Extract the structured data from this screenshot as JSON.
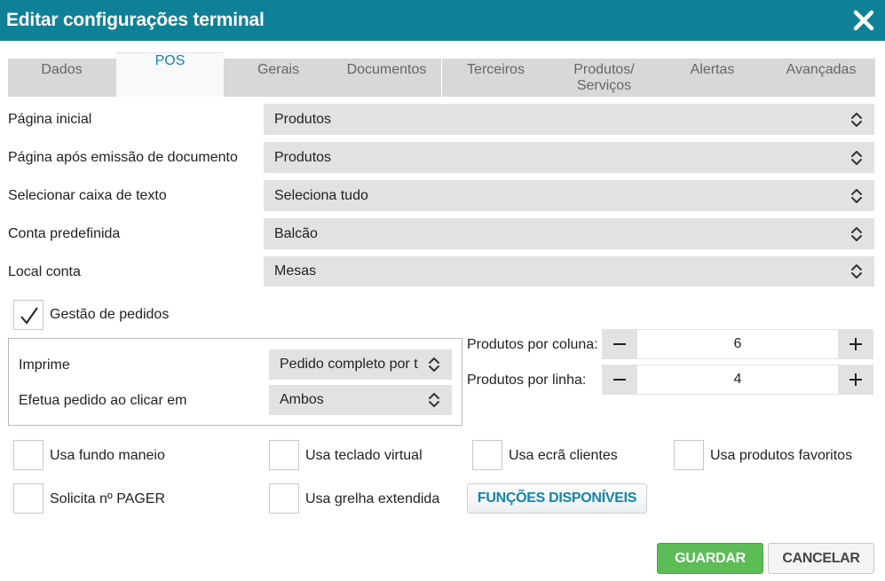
{
  "dialog": {
    "title": "Editar configurações terminal"
  },
  "tabs": [
    {
      "label": "Dados",
      "active": false
    },
    {
      "label": "POS",
      "active": true
    },
    {
      "label": "Gerais",
      "active": false
    },
    {
      "label": "Documentos",
      "active": false
    },
    {
      "label": "Terceiros",
      "active": false
    },
    {
      "label": "Produtos/\nServiços",
      "active": false
    },
    {
      "label": "Alertas",
      "active": false
    },
    {
      "label": "Avançadas",
      "active": false
    }
  ],
  "fields": [
    {
      "label": "Página inicial",
      "value": "Produtos"
    },
    {
      "label": "Página após emissão de documento",
      "value": "Produtos"
    },
    {
      "label": "Selecionar caixa de texto",
      "value": "Seleciona tudo"
    },
    {
      "label": "Conta predefinida",
      "value": "Balcão"
    },
    {
      "label": "Local conta",
      "value": "Mesas"
    }
  ],
  "gestao": {
    "label": "Gestão de pedidos",
    "checked": true
  },
  "group": {
    "imprime": {
      "label": "Imprime",
      "value": "Pedido completo por t"
    },
    "efetua": {
      "label": "Efetua pedido ao clicar em",
      "value": "Ambos"
    }
  },
  "steppers": {
    "coluna": {
      "label": "Produtos por coluna:",
      "value": "6"
    },
    "linha": {
      "label": "Produtos por linha:",
      "value": "4"
    }
  },
  "checkboxes": [
    {
      "label": "Usa fundo maneio",
      "checked": false
    },
    {
      "label": "Usa teclado virtual",
      "checked": false
    },
    {
      "label": "Usa ecrã clientes",
      "checked": false
    },
    {
      "label": "Usa produtos favoritos",
      "checked": false
    },
    {
      "label": "Solicita nº PAGER",
      "checked": false
    },
    {
      "label": "Usa grelha extendida",
      "checked": false
    }
  ],
  "buttons": {
    "funcoes": "FUNÇÕES DISPONÍVEIS",
    "save": "GUARDAR",
    "cancel": "CANCELAR"
  },
  "colors": {
    "header": "#0f8196",
    "accent": "#1584a8",
    "save": "#5cbc55"
  }
}
